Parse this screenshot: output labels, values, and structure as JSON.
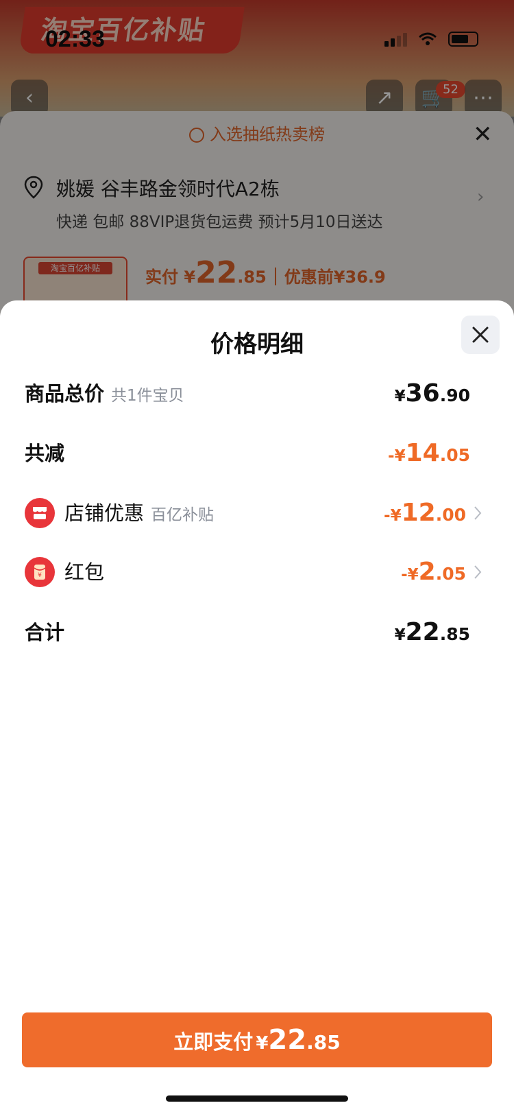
{
  "status_bar": {
    "time": "02:33"
  },
  "background": {
    "banner": "淘宝百亿补贴",
    "cart_count": "52",
    "rank_text": "入选抽纸热卖榜",
    "address_name": "姚媛 谷丰路金领时代A2栋",
    "address_sub": "快递 包邮 88VIP退货包运费 预计5月10日送达",
    "thumb_label": "淘宝百亿补贴",
    "pay_label": "实付 ¥",
    "pay_int": "22",
    "pay_dec": ".85",
    "before_price": "优惠前¥36.9"
  },
  "sheet": {
    "title": "价格明细",
    "rows": [
      {
        "label": "商品总价",
        "sublabel": "共1件宝贝",
        "sym": "¥",
        "int": "36",
        "dec": ".90"
      },
      {
        "label": "共减",
        "sym": "-¥",
        "int": "14",
        "dec": ".05"
      },
      {
        "label": "店铺优惠",
        "sublabel": "百亿补贴",
        "sym": "-¥",
        "int": "12",
        "dec": ".00",
        "icon": "shop-icon"
      },
      {
        "label": "红包",
        "sym": "-¥",
        "int": "2",
        "dec": ".05",
        "icon": "red-packet-icon"
      },
      {
        "label": "合计",
        "sym": "¥",
        "int": "22",
        "dec": ".85"
      }
    ],
    "pay_button": {
      "label": "立即支付",
      "sym": "¥",
      "int": "22",
      "dec": ".85"
    }
  },
  "colors": {
    "accent": "#ef6c2c",
    "discount": "#ef6a26",
    "icon_red": "#e8353a"
  }
}
